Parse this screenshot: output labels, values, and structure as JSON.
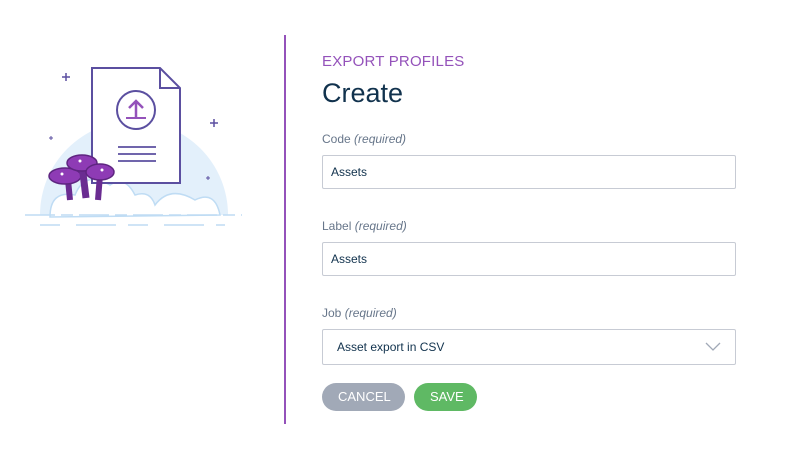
{
  "header": {
    "eyebrow": "EXPORT PROFILES",
    "title": "Create"
  },
  "form": {
    "code": {
      "label": "Code",
      "required": "(required)",
      "value": "Assets"
    },
    "label": {
      "label": "Label",
      "required": "(required)",
      "value": "Assets"
    },
    "job": {
      "label": "Job",
      "required": "(required)",
      "value": "Asset export in CSV"
    }
  },
  "actions": {
    "cancel_label": "CANCEL",
    "save_label": "SAVE"
  },
  "colors": {
    "accent": "#9452ba",
    "title": "#11324d",
    "save": "#5fb964",
    "cancel": "#a1a9b7"
  },
  "icons": [
    "upload-document-illustration",
    "chevron-down-icon"
  ]
}
